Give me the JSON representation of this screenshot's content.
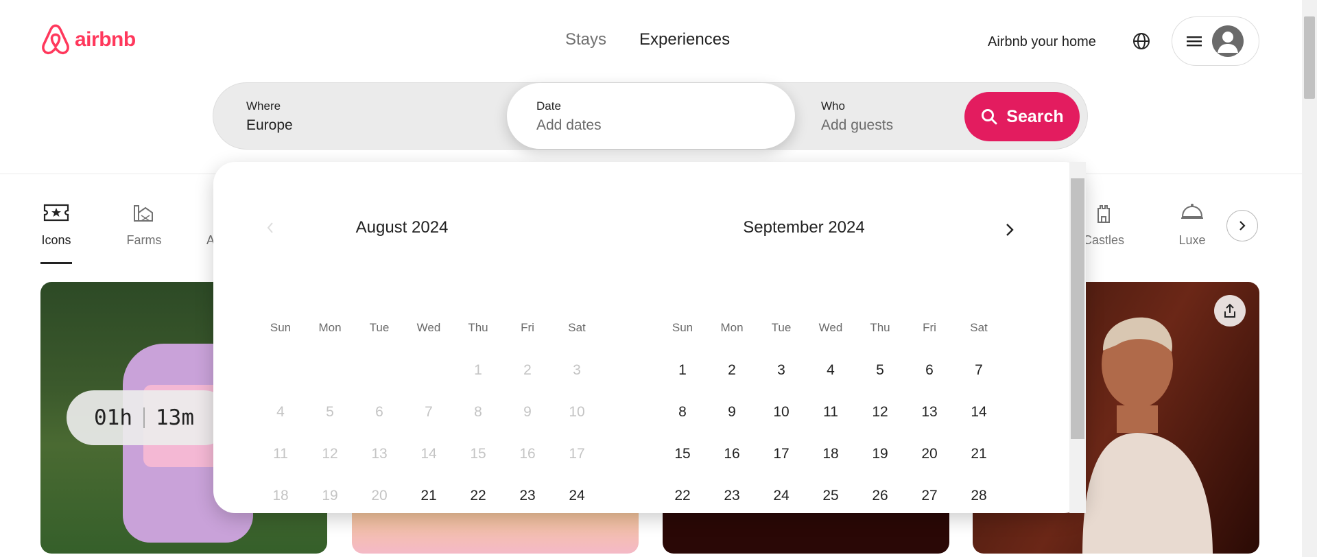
{
  "header": {
    "brand": "airbnb",
    "tabs": [
      {
        "label": "Stays",
        "active": false
      },
      {
        "label": "Experiences",
        "active": true
      }
    ],
    "host_link": "Airbnb your home",
    "icons": {
      "globe": "globe-icon",
      "menu": "menu-icon",
      "avatar": "user-avatar-icon"
    }
  },
  "search": {
    "where_label": "Where",
    "where_value": "Europe",
    "date_label": "Date",
    "date_placeholder": "Add dates",
    "who_label": "Who",
    "who_placeholder": "Add guests",
    "button_label": "Search"
  },
  "categories": [
    {
      "label": "Icons",
      "icon": "ticket-star-icon",
      "active": true
    },
    {
      "label": "Farms",
      "icon": "farm-icon",
      "active": false
    },
    {
      "label": "A",
      "icon": "",
      "active": false
    },
    {
      "label": "Castles",
      "icon": "castle-icon",
      "active": false
    },
    {
      "label": "Luxe",
      "icon": "cloche-icon",
      "active": false
    }
  ],
  "cards": {
    "timer": {
      "hours": "01h",
      "minutes": "13m"
    }
  },
  "calendar": {
    "months": [
      {
        "title": "August 2024",
        "weekdays": [
          "Sun",
          "Mon",
          "Tue",
          "Wed",
          "Thu",
          "Fri",
          "Sat"
        ],
        "first_weekday": 4,
        "days_shown": 24,
        "first_available": 21
      },
      {
        "title": "September 2024",
        "weekdays": [
          "Sun",
          "Mon",
          "Tue",
          "Wed",
          "Thu",
          "Fri",
          "Sat"
        ],
        "first_weekday": 0,
        "days_shown": 28,
        "first_available": 1
      }
    ]
  },
  "colors": {
    "brand": "#ff385c",
    "search_button": "#e31c5f"
  }
}
